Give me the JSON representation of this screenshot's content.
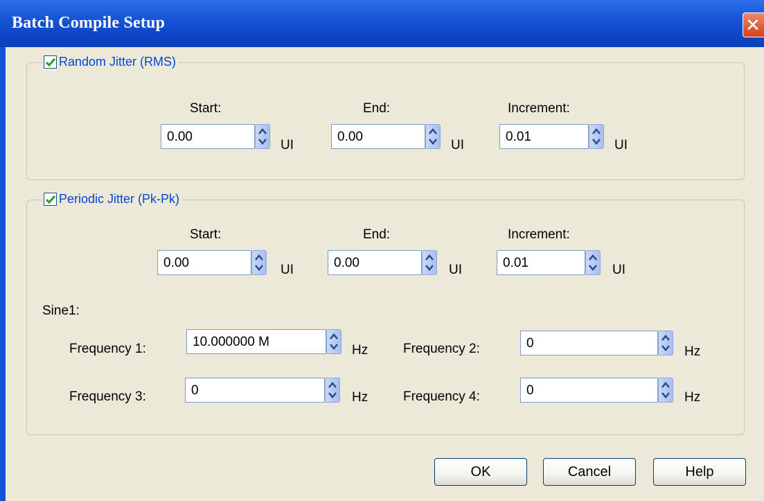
{
  "window": {
    "title": "Batch Compile Setup",
    "close_glyph": "✕"
  },
  "random_jitter": {
    "label": "Random Jitter (RMS)",
    "checked": true,
    "start_label": "Start:",
    "end_label": "End:",
    "increment_label": "Increment:",
    "start_value": "0.00",
    "end_value": "0.00",
    "increment_value": "0.01",
    "unit": "UI"
  },
  "periodic_jitter": {
    "label": "Periodic Jitter (Pk-Pk)",
    "checked": true,
    "start_label": "Start:",
    "end_label": "End:",
    "increment_label": "Increment:",
    "start_value": "0.00",
    "end_value": "0.00",
    "increment_value": "0.01",
    "unit": "UI",
    "sine_label": "Sine1:",
    "frequencies": [
      {
        "label": "Frequency 1:",
        "value": "10.000000 M",
        "unit": "Hz"
      },
      {
        "label": "Frequency 2:",
        "value": "0",
        "unit": "Hz"
      },
      {
        "label": "Frequency 3:",
        "value": "0",
        "unit": "Hz"
      },
      {
        "label": "Frequency 4:",
        "value": "0",
        "unit": "Hz"
      }
    ]
  },
  "buttons": {
    "ok": "OK",
    "cancel": "Cancel",
    "help": "Help"
  },
  "colors": {
    "titlebar": "#1a57d8",
    "legend_text": "#0046d5",
    "dialog_bg": "#ece9d8"
  },
  "icons": {
    "checkbox_mark": "checkmark-icon",
    "spin": "spin-arrows-icon",
    "close": "close-icon"
  }
}
